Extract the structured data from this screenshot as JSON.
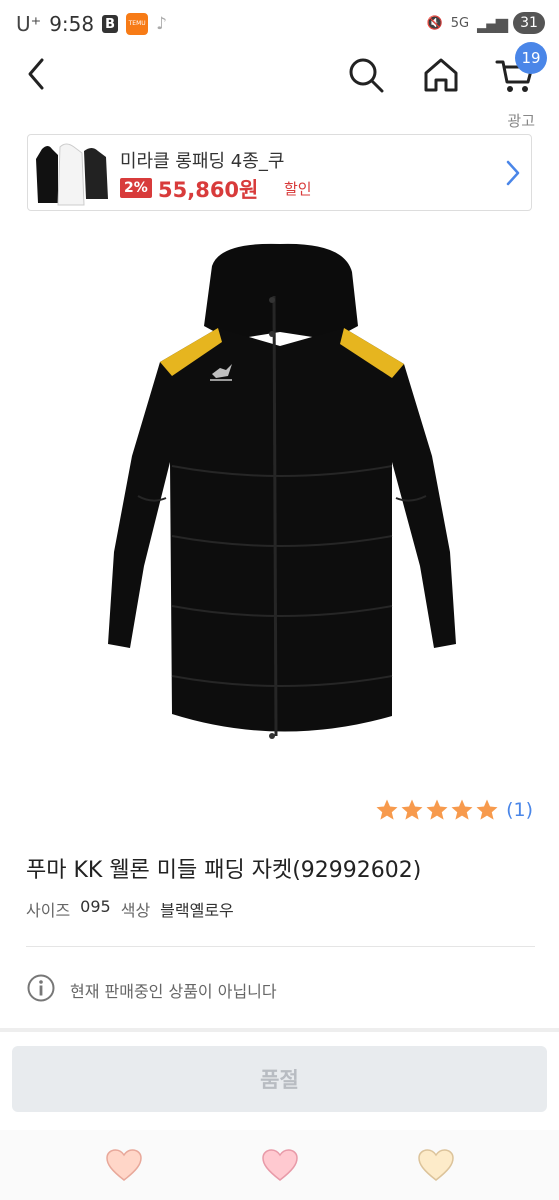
{
  "status_bar": {
    "carrier": "U⁺",
    "time": "9:58",
    "app_b": "B",
    "app_temu": "TEMU",
    "net": "5G",
    "battery": "31"
  },
  "nav": {
    "cart_count": "19",
    "icons": [
      "back-icon",
      "search-icon",
      "home-icon",
      "cart-icon"
    ]
  },
  "ad": {
    "label": "광고",
    "title": "미라클 롱패딩 4종_쿠",
    "discount": "2%",
    "price": "55,860원",
    "sale_label": "할인"
  },
  "product": {
    "rating_count": "(1)",
    "title": "푸마 KK 웰론 미들 패딩 자켓(92992602)",
    "size_label": "사이즈",
    "size_value": "095",
    "color_label": "색상",
    "color_value": "블랙옐로우",
    "notice": "현재 판매중인 상품이 아닙니다"
  },
  "actions": {
    "soldout_label": "품절"
  },
  "colors": {
    "accent": "#4a86e8",
    "sale_red": "#d83b3b",
    "star": "#f79a4d",
    "heart": "#ffc9d0"
  }
}
